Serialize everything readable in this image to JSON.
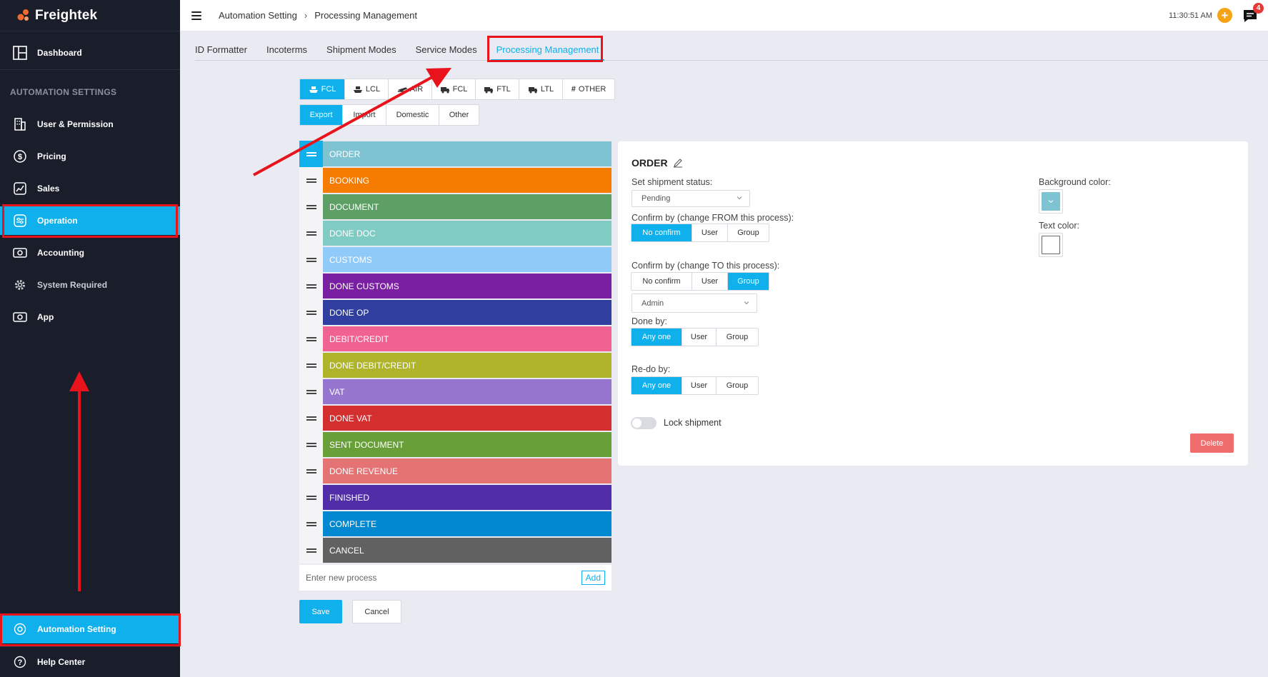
{
  "app": {
    "name": "Freightek"
  },
  "sidebar": {
    "dashboard": "Dashboard",
    "section_title": "AUTOMATION SETTINGS",
    "items": [
      {
        "label": "User & Permission",
        "icon": "building-icon"
      },
      {
        "label": "Pricing",
        "icon": "dollar-icon"
      },
      {
        "label": "Sales",
        "icon": "chart-icon"
      },
      {
        "label": "Operation",
        "icon": "sliders-icon",
        "active": true
      },
      {
        "label": "Accounting",
        "icon": "money-icon"
      },
      {
        "label": "System Required",
        "icon": "gear-icon"
      },
      {
        "label": "App",
        "icon": "app-icon"
      }
    ],
    "automation_setting": "Automation Setting",
    "help_center": "Help Center"
  },
  "topbar": {
    "breadcrumb": [
      "Automation Setting",
      "Processing Management"
    ],
    "time": "11:30:51 AM",
    "plus": "+",
    "notification_count": "4"
  },
  "tabs": [
    "ID Formatter",
    "Incoterms",
    "Shipment Modes",
    "Service Modes",
    "Processing Management"
  ],
  "active_tab": "Processing Management",
  "modes": [
    {
      "label": "FCL",
      "icon": "ship-icon",
      "selected": true
    },
    {
      "label": "LCL",
      "icon": "ship-icon"
    },
    {
      "label": "AIR",
      "icon": "plane-icon"
    },
    {
      "label": "FCL",
      "icon": "truck-icon"
    },
    {
      "label": "FTL",
      "icon": "truck-icon"
    },
    {
      "label": "LTL",
      "icon": "truck-icon"
    },
    {
      "label": "OTHER",
      "icon": "hash-icon"
    }
  ],
  "directions": [
    {
      "label": "Export",
      "selected": true
    },
    {
      "label": "Import"
    },
    {
      "label": "Domestic"
    },
    {
      "label": "Other"
    }
  ],
  "processes": [
    {
      "label": "ORDER",
      "color": "#7ec3d2",
      "selected": true
    },
    {
      "label": "BOOKING",
      "color": "#f57c00"
    },
    {
      "label": "DOCUMENT",
      "color": "#5e9f66"
    },
    {
      "label": "DONE DOC",
      "color": "#80cbc4"
    },
    {
      "label": "CUSTOMS",
      "color": "#90caf9"
    },
    {
      "label": "DONE CUSTOMS",
      "color": "#7b1fa2"
    },
    {
      "label": "DONE OP",
      "color": "#303f9f"
    },
    {
      "label": "DEBIT/CREDIT",
      "color": "#f06292"
    },
    {
      "label": "DONE DEBIT/CREDIT",
      "color": "#afb42b"
    },
    {
      "label": "VAT",
      "color": "#9575cd"
    },
    {
      "label": "DONE VAT",
      "color": "#d32f2f"
    },
    {
      "label": "SENT DOCUMENT",
      "color": "#689f38"
    },
    {
      "label": "DONE REVENUE",
      "color": "#e57373"
    },
    {
      "label": "FINISHED",
      "color": "#512da8"
    },
    {
      "label": "COMPLETE",
      "color": "#0288d1"
    },
    {
      "label": "CANCEL",
      "color": "#616161"
    }
  ],
  "new_process": {
    "placeholder": "Enter new process",
    "add_label": "Add"
  },
  "actions": {
    "save": "Save",
    "cancel": "Cancel"
  },
  "detail": {
    "title": "ORDER",
    "shipment_status_label": "Set shipment status:",
    "shipment_status_value": "Pending",
    "confirm_from_label": "Confirm by (change FROM this process):",
    "confirm_from_options": [
      "No confirm",
      "User",
      "Group"
    ],
    "confirm_from_selected": "No confirm",
    "confirm_to_label": "Confirm by (change TO this process):",
    "confirm_to_options": [
      "No confirm",
      "User",
      "Group"
    ],
    "confirm_to_selected": "Group",
    "group_value": "Admin",
    "done_by_label": "Done by:",
    "done_by_options": [
      "Any one",
      "User",
      "Group"
    ],
    "done_by_selected": "Any one",
    "redo_by_label": "Re-do by:",
    "redo_by_options": [
      "Any one",
      "User",
      "Group"
    ],
    "redo_by_selected": "Any one",
    "lock_label": "Lock shipment",
    "lock_on": false,
    "bg_color_label": "Background color:",
    "bg_color": "#7ec3d2",
    "text_color_label": "Text color:",
    "text_color": "#ffffff",
    "delete_label": "Delete"
  },
  "colors": {
    "accent": "#0fb0ec",
    "sidebar": "#1a1e2b",
    "annotation": "#e8131b"
  }
}
